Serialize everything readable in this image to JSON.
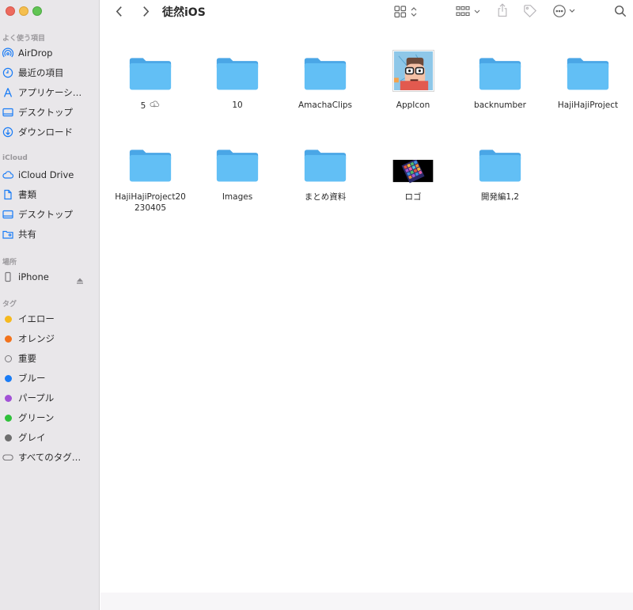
{
  "window": {
    "title": "徒然iOS"
  },
  "sidebar": {
    "favorites_title": "よく使う項目",
    "favorites": [
      {
        "label": "AirDrop",
        "icon": "airdrop-icon"
      },
      {
        "label": "最近の項目",
        "icon": "clock-icon"
      },
      {
        "label": "アプリケーシ…",
        "icon": "applications-icon"
      },
      {
        "label": "デスクトップ",
        "icon": "desktop-icon"
      },
      {
        "label": "ダウンロード",
        "icon": "download-icon"
      }
    ],
    "icloud_title": "iCloud",
    "icloud": [
      {
        "label": "iCloud Drive",
        "icon": "cloud-icon"
      },
      {
        "label": "書類",
        "icon": "document-icon"
      },
      {
        "label": "デスクトップ",
        "icon": "desktop-icon"
      },
      {
        "label": "共有",
        "icon": "shared-folder-icon"
      }
    ],
    "locations_title": "場所",
    "locations": [
      {
        "label": "iPhone",
        "icon": "iphone-icon"
      }
    ],
    "tags_title": "タグ",
    "tags": [
      {
        "label": "イエロー",
        "color": "#f6b91f"
      },
      {
        "label": "オレンジ",
        "color": "#f2731c"
      },
      {
        "label": "重要",
        "color": ""
      },
      {
        "label": "ブルー",
        "color": "#1a7cf6"
      },
      {
        "label": "パープル",
        "color": "#a251d6"
      },
      {
        "label": "グリーン",
        "color": "#30c13b"
      },
      {
        "label": "グレイ",
        "color": "#6e6e6e"
      },
      {
        "label": "すべてのタグ…",
        "color": ""
      }
    ]
  },
  "files": [
    {
      "name": "5",
      "kind": "folder",
      "icloud": true
    },
    {
      "name": "10",
      "kind": "folder"
    },
    {
      "name": "AmachaClips",
      "kind": "folder"
    },
    {
      "name": "AppIcon",
      "kind": "image-appicon"
    },
    {
      "name": "backnumber",
      "kind": "folder"
    },
    {
      "name": "HajiHajiProject",
      "kind": "folder"
    },
    {
      "name": "HajiHajiProject20230405",
      "kind": "folder"
    },
    {
      "name": "Images",
      "kind": "folder"
    },
    {
      "name": "まとめ資料",
      "kind": "folder"
    },
    {
      "name": "ロゴ",
      "kind": "image-logo"
    },
    {
      "name": "開発編1,2",
      "kind": "folder"
    }
  ],
  "colors": {
    "folder": "#62bff5",
    "folder_tab": "#4aa6e6",
    "accent": "#1a7cf6"
  }
}
